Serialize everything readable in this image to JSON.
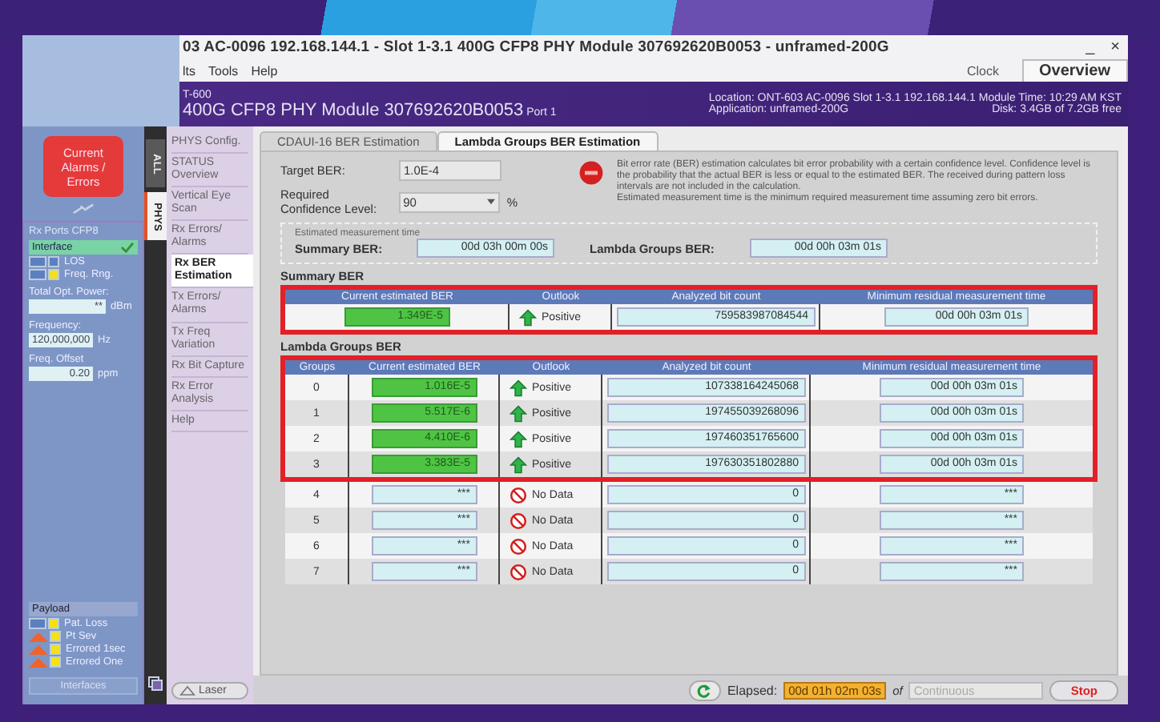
{
  "window": {
    "title": "03  AC-0096  192.168.144.1 - Slot 1-3.1 400G CFP8 PHY Module 307692620B0053 - unframed-200G",
    "minimize": "_",
    "close": "×"
  },
  "menu": [
    "lts",
    "Tools",
    "Help"
  ],
  "toolbar": {
    "clock": "Clock",
    "overview": "Overview"
  },
  "header": {
    "model": "T-600",
    "module": "400G CFP8 PHY Module 307692620B0053",
    "port": "Port 1",
    "location": "Location: ONT-603 AC-0096 Slot 1-3.1  192.168.144.1 Module Time: 10:29 AM KST",
    "application": "Application: unframed-200G",
    "disk": "Disk: 3.4GB of 7.2GB free"
  },
  "left_panel": {
    "alarm_button": "Current Alarms / Errors",
    "ports_title": "Rx Ports CFP8",
    "interface": "Interface",
    "interface_ok": true,
    "indicators": [
      {
        "label": "LOS",
        "kind": "clear"
      },
      {
        "label": "Freq. Rng.",
        "kind": "history"
      }
    ],
    "fields": [
      {
        "label": "Total Opt. Power:",
        "value": "**",
        "unit": "dBm"
      },
      {
        "label": "Frequency:",
        "value": "120,000,000",
        "unit": "Hz"
      },
      {
        "label": "Freq. Offset",
        "value": "0.20",
        "unit": "ppm"
      }
    ],
    "payload_title": "Payload",
    "payload": [
      {
        "label": "Pat. Loss",
        "kind": "history"
      },
      {
        "label": "Pt Sev",
        "kind": "alarm"
      },
      {
        "label": "Errored 1sec",
        "kind": "alarm"
      },
      {
        "label": "Errored One",
        "kind": "alarm"
      }
    ],
    "interfaces_button": "Interfaces"
  },
  "side_tabs": [
    {
      "label": "ALL",
      "selected": false
    },
    {
      "label": "PHYS",
      "selected": true
    }
  ],
  "nav": [
    {
      "label": "PHYS Config.",
      "selected": false
    },
    {
      "label": "STATUS Overview",
      "selected": false
    },
    {
      "label": "Vertical Eye Scan",
      "selected": false
    },
    {
      "label": "Rx Errors/ Alarms",
      "selected": false
    },
    {
      "label": "Rx BER Estimation",
      "selected": true
    },
    {
      "label": "Tx Errors/ Alarms",
      "selected": false
    },
    {
      "label": "Tx Freq Variation",
      "selected": false
    },
    {
      "label": "Rx Bit Capture",
      "selected": false
    },
    {
      "label": "Rx Error Analysis",
      "selected": false
    },
    {
      "label": "Help",
      "selected": false
    }
  ],
  "tabs": [
    {
      "label": "CDAUI-16 BER Estimation",
      "selected": false
    },
    {
      "label": "Lambda Groups BER Estimation",
      "selected": true
    }
  ],
  "settings": {
    "target_label": "Target BER:",
    "target_value": "1.0E-4",
    "confidence_label": "Required Confidence Level:",
    "confidence_value": "90",
    "confidence_unit": "%",
    "info": "Bit error rate (BER) estimation calculates bit error probability with a certain confidence level. Confidence level is the probability that the actual BER is less or equal to the estimated BER. The received during pattern loss intervals are not included in the calculation.",
    "info_2": "Estimated measurement time is the minimum required measurement time assuming zero bit errors."
  },
  "estimated_time": {
    "legend": "Estimated measurement time",
    "summary_label": "Summary BER:",
    "summary_value": "00d 03h 00m 00s",
    "lambda_label": "Lambda Groups BER:",
    "lambda_value": "00d 00h 03m 01s"
  },
  "summary": {
    "title": "Summary BER",
    "highlighted": true,
    "columns": [
      "Current estimated BER",
      "Outlook",
      "Analyzed bit count",
      "Minimum residual measurement time"
    ],
    "rows": [
      {
        "ber": "1.349E-5",
        "outlook": "Positive",
        "kind": "positive",
        "bit_count": "759583987084544",
        "time": "00d 00h 03m 01s"
      }
    ]
  },
  "lambda": {
    "title": "Lambda Groups BER",
    "highlighted": true,
    "columns": [
      "Groups",
      "Current estimated BER",
      "Outlook",
      "Analyzed bit count",
      "Minimum residual measurement time"
    ],
    "rows": [
      {
        "group": "0",
        "ber": "1.016E-5",
        "outlook": "Positive",
        "kind": "positive",
        "bit_count": "107338164245068",
        "time": "00d 00h 03m 01s"
      },
      {
        "group": "1",
        "ber": "5.517E-6",
        "outlook": "Positive",
        "kind": "positive",
        "bit_count": "197455039268096",
        "time": "00d 00h 03m 01s"
      },
      {
        "group": "2",
        "ber": "4.410E-6",
        "outlook": "Positive",
        "kind": "positive",
        "bit_count": "197460351765600",
        "time": "00d 00h 03m 01s"
      },
      {
        "group": "3",
        "ber": "3.383E-5",
        "outlook": "Positive",
        "kind": "positive",
        "bit_count": "197630351802880",
        "time": "00d 00h 03m 01s"
      },
      {
        "group": "4",
        "ber": "***",
        "outlook": "No Data",
        "kind": "nodata",
        "bit_count": "0",
        "time": "***"
      },
      {
        "group": "5",
        "ber": "***",
        "outlook": "No Data",
        "kind": "nodata",
        "bit_count": "0",
        "time": "***"
      },
      {
        "group": "6",
        "ber": "***",
        "outlook": "No Data",
        "kind": "nodata",
        "bit_count": "0",
        "time": "***"
      },
      {
        "group": "7",
        "ber": "***",
        "outlook": "No Data",
        "kind": "nodata",
        "bit_count": "0",
        "time": "***"
      }
    ]
  },
  "bottom": {
    "laser": "Laser",
    "elapsed_label": "Elapsed:",
    "elapsed": "00d 01h 02m 03s",
    "of": "of",
    "duration": "Continuous",
    "stop": "Stop"
  }
}
